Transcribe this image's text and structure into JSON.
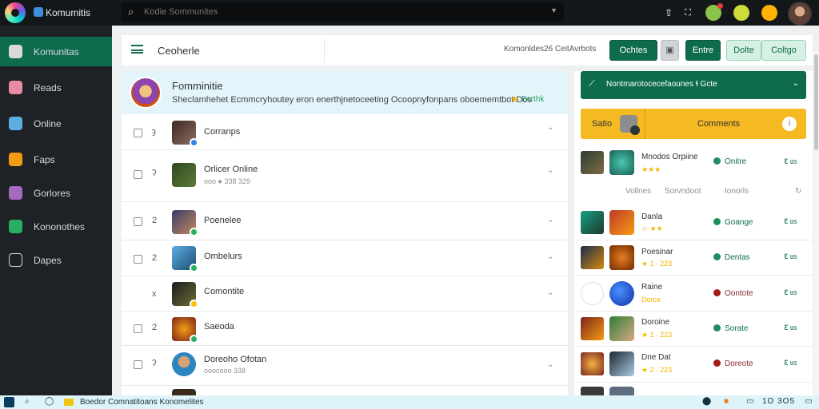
{
  "app": {
    "title": "Komumitis"
  },
  "search": {
    "placeholder": "Kodie Sommunites"
  },
  "sidebar": {
    "items": [
      {
        "label": "Komunitas",
        "icon": "community-icon",
        "active": true
      },
      {
        "label": "Reads",
        "icon": "reads-icon"
      },
      {
        "label": "Online",
        "icon": "online-icon"
      },
      {
        "label": "Faps",
        "icon": "faps-icon"
      },
      {
        "label": "Gorlores",
        "icon": "gorlores-icon"
      },
      {
        "label": "Kononothes",
        "icon": "kononothes-icon"
      },
      {
        "label": "Dapes",
        "icon": "dapes-icon"
      }
    ]
  },
  "toolbar": {
    "title": "Ceoherle",
    "meta": "Komonldes26 CeitAvrbots",
    "buttons": [
      "Ochtes",
      "Entre",
      "Dolte",
      "Coltgo"
    ]
  },
  "feature": {
    "title": "Fomminitie",
    "description": "Sheclamhehet Ecmmcryhoutey eron enerthjnetoceeting Ocoopnyfonpans oboememtbot Dos",
    "tag": "Ecrthk"
  },
  "list": [
    {
      "mark": "ȝ",
      "name": "Corranps",
      "sub": ""
    },
    {
      "mark": "ʔ",
      "name": "Orlicer Online",
      "sub": "ooo ● 338 329"
    },
    {
      "mark": "2",
      "name": "Poenelee",
      "sub": ""
    },
    {
      "mark": "2",
      "name": "Ombelurs",
      "sub": ""
    },
    {
      "mark": "x",
      "name": "Comontite",
      "sub": ""
    },
    {
      "mark": "2",
      "name": "Saeoda",
      "sub": ""
    },
    {
      "mark": "ʔ",
      "name": "Doreoho Ofotan",
      "sub": "ooocooo 338"
    }
  ],
  "panel": {
    "header": "Nontmarotocecefaounes ɬ Gcte",
    "tab_left": "Satio",
    "tab_right": "Comments",
    "subbar": [
      "Vollnes",
      "Sorvndoot",
      "Ionorls"
    ],
    "rows": [
      {
        "name": "Mnodos Orpiine",
        "rating": "★★★",
        "status": "Onitre",
        "online": true
      },
      {
        "name": "Danla",
        "rating": "☆ ★★",
        "status": "Goange",
        "online": true
      },
      {
        "name": "Poesinar",
        "rating": "★ 1 ∙ 223",
        "status": "Dentas",
        "online": true
      },
      {
        "name": "Raine",
        "rating": "Dorce",
        "status": "Oontote",
        "online": false
      },
      {
        "name": "Doroine",
        "rating": "★ 1 ∙ 223",
        "status": "Sorate",
        "online": true
      },
      {
        "name": "Dne Dat",
        "rating": "★ 2 ∙ 223",
        "status": "Doreote",
        "online": false
      }
    ],
    "action": "ℇ ɩɩs"
  },
  "taskbar": {
    "text": "Boedor Comnatitoans Konomelites",
    "time": "1O 3O5"
  }
}
